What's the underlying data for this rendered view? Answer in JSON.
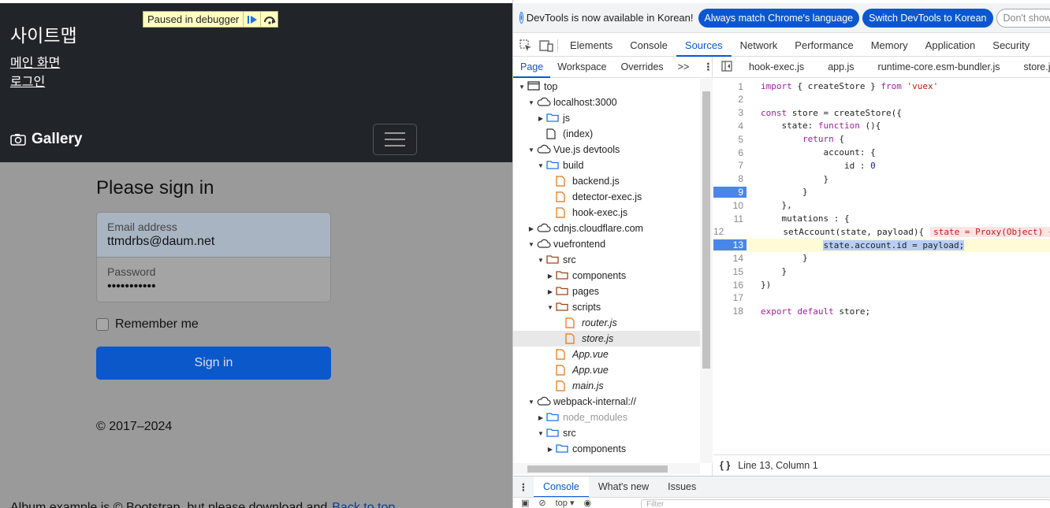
{
  "page": {
    "site_title": "사이트맵",
    "links": [
      "메인 화면",
      "로그인"
    ],
    "debugger_banner": "Paused in debugger",
    "brand": "Gallery",
    "signin_title": "Please sign in",
    "email_label": "Email address",
    "email_value": "ttmdrbs@daum.net",
    "password_label": "Password",
    "password_value": "•••••••••••",
    "remember_label": "Remember me",
    "signin_button": "Sign in",
    "copyright": "© 2017–2024",
    "footer_text": "Album example is © Bootstrap, but please download and",
    "back_to_top": "Back to top"
  },
  "devtools": {
    "info_message": "DevTools is now available in Korean!",
    "btn_match": "Always match Chrome's language",
    "btn_switch": "Switch DevTools to Korean",
    "btn_dont_show": "Don't show agai",
    "main_tabs": [
      "Elements",
      "Console",
      "Sources",
      "Network",
      "Performance",
      "Memory",
      "Application",
      "Security"
    ],
    "active_main_tab": "Sources",
    "nav_tabs": [
      "Page",
      "Workspace",
      "Overrides"
    ],
    "nav_more": ">>",
    "editor_tabs": [
      "hook-exec.js",
      "app.js",
      "runtime-core.esm-bundler.js",
      "store.js"
    ],
    "tree": [
      {
        "label": "top",
        "depth": 0,
        "arrow": "▼",
        "icon": "frame-icon"
      },
      {
        "label": "localhost:3000",
        "depth": 1,
        "arrow": "▼",
        "icon": "cloud-icon"
      },
      {
        "label": "js",
        "depth": 2,
        "arrow": "▶",
        "icon": "folder-blue-icon"
      },
      {
        "label": "(index)",
        "depth": 2,
        "arrow": "",
        "icon": "file-icon"
      },
      {
        "label": "Vue.js devtools",
        "depth": 1,
        "arrow": "▼",
        "icon": "cloud-icon"
      },
      {
        "label": "build",
        "depth": 2,
        "arrow": "▼",
        "icon": "folder-blue-icon"
      },
      {
        "label": "backend.js",
        "depth": 3,
        "arrow": "",
        "icon": "js-file-icon"
      },
      {
        "label": "detector-exec.js",
        "depth": 3,
        "arrow": "",
        "icon": "js-file-icon"
      },
      {
        "label": "hook-exec.js",
        "depth": 3,
        "arrow": "",
        "icon": "js-file-icon"
      },
      {
        "label": "cdnjs.cloudflare.com",
        "depth": 1,
        "arrow": "▶",
        "icon": "cloud-icon"
      },
      {
        "label": "vuefrontend",
        "depth": 1,
        "arrow": "▼",
        "icon": "cloud-icon"
      },
      {
        "label": "src",
        "depth": 2,
        "arrow": "▼",
        "icon": "folder-orange-icon"
      },
      {
        "label": "components",
        "depth": 3,
        "arrow": "▶",
        "icon": "folder-orange-icon"
      },
      {
        "label": "pages",
        "depth": 3,
        "arrow": "▶",
        "icon": "folder-orange-icon"
      },
      {
        "label": "scripts",
        "depth": 3,
        "arrow": "▼",
        "icon": "folder-orange-icon"
      },
      {
        "label": "router.js",
        "depth": 4,
        "arrow": "",
        "icon": "js-file-icon",
        "italic": true
      },
      {
        "label": "store.js",
        "depth": 4,
        "arrow": "",
        "icon": "js-file-icon",
        "italic": true,
        "selected": true
      },
      {
        "label": "App.vue",
        "depth": 3,
        "arrow": "",
        "icon": "js-file-icon",
        "italic": true
      },
      {
        "label": "App.vue",
        "depth": 3,
        "arrow": "",
        "icon": "js-file-icon",
        "italic": true
      },
      {
        "label": "main.js",
        "depth": 3,
        "arrow": "",
        "icon": "js-file-icon",
        "italic": true
      },
      {
        "label": "webpack-internal://",
        "depth": 1,
        "arrow": "▼",
        "icon": "cloud-icon"
      },
      {
        "label": "node_modules",
        "depth": 2,
        "arrow": "▶",
        "icon": "folder-blue-icon",
        "dim": true
      },
      {
        "label": "src",
        "depth": 2,
        "arrow": "▼",
        "icon": "folder-blue-icon"
      },
      {
        "label": "components",
        "depth": 3,
        "arrow": "▶",
        "icon": "folder-blue-icon"
      }
    ],
    "code_lines": [
      {
        "n": "1",
        "text": "import { createStore } from 'vuex'"
      },
      {
        "n": "2",
        "text": ""
      },
      {
        "n": "3",
        "text": "const store = createStore({"
      },
      {
        "n": "4",
        "text": "    state: function (){"
      },
      {
        "n": "5",
        "text": "        return {"
      },
      {
        "n": "6",
        "text": "            account: {"
      },
      {
        "n": "7",
        "text": "                id : 0"
      },
      {
        "n": "8",
        "text": "            }"
      },
      {
        "n": "9",
        "text": "        }",
        "bp": true
      },
      {
        "n": "10",
        "text": "    },"
      },
      {
        "n": "11",
        "text": "    mutations : {"
      },
      {
        "n": "12",
        "text": "        setAccount(state, payload){",
        "inline": "state = Proxy(Object) {a"
      },
      {
        "n": "13",
        "text": "            state.account.id = payload;",
        "bp": true,
        "current": true
      },
      {
        "n": "14",
        "text": "        }"
      },
      {
        "n": "15",
        "text": "    }"
      },
      {
        "n": "16",
        "text": "})"
      },
      {
        "n": "17",
        "text": ""
      },
      {
        "n": "18",
        "text": "export default store;"
      }
    ],
    "status": "Line 13, Column 1",
    "drawer_tabs": [
      "Console",
      "What's new",
      "Issues"
    ],
    "console_context": "top",
    "filter_placeholder": "Filter"
  }
}
